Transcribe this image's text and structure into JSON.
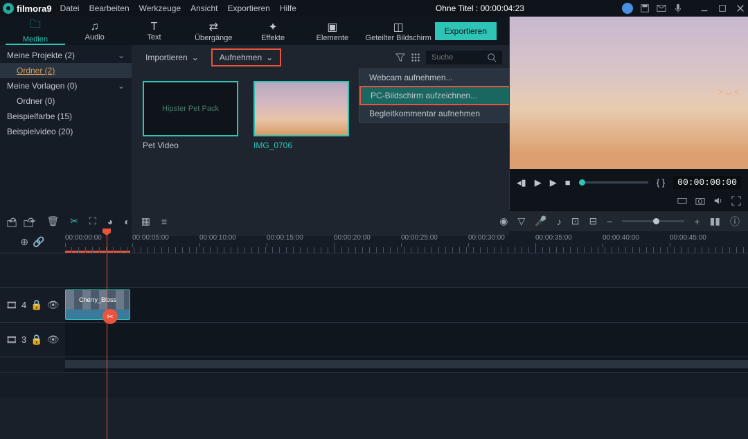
{
  "app": {
    "logo_text": "filmora9"
  },
  "menu": [
    "Datei",
    "Bearbeiten",
    "Werkzeuge",
    "Ansicht",
    "Exportieren",
    "Hilfe"
  ],
  "title": "Ohne Titel : 00:00:04:23",
  "tabs": [
    {
      "label": "Medien",
      "icon": "folder"
    },
    {
      "label": "Audio",
      "icon": "music"
    },
    {
      "label": "Text",
      "icon": "text"
    },
    {
      "label": "Übergänge",
      "icon": "transition"
    },
    {
      "label": "Effekte",
      "icon": "effects"
    },
    {
      "label": "Elemente",
      "icon": "elements"
    },
    {
      "label": "Geteilter Bildschirm",
      "icon": "split"
    }
  ],
  "export_btn": "Exportieren",
  "import_label": "Importieren",
  "record_label": "Aufnehmen",
  "record_menu": [
    "Webcam aufnehmen...",
    "PC-Bildschirm aufzeichnen...",
    "Begleitkommentar aufnehmen"
  ],
  "sidebar": {
    "items": [
      {
        "label": "Meine Projekte (2)",
        "expand": true
      },
      {
        "label": "Ordner  (2)",
        "sub": true,
        "selected": true
      },
      {
        "label": "Meine Vorlagen (0)",
        "expand": true
      },
      {
        "label": "Ordner (0)",
        "sub_plain": true
      },
      {
        "label": "Beispielfarbe (15)"
      },
      {
        "label": "Beispielvideo (20)"
      }
    ]
  },
  "search_placeholder": "Suche",
  "thumbs": [
    {
      "label": "Pet Video",
      "overlay": "Hipster Pet Pack"
    },
    {
      "label": "IMG_0706"
    }
  ],
  "preview": {
    "timecode": "00:00:00:00",
    "markers": "{  }"
  },
  "ruler": [
    "00:00:00:00",
    "00:00:05:00",
    "00:00:10:00",
    "00:00:15:00",
    "00:00:20:00",
    "00:00:25:00",
    "00:00:30:00",
    "00:00:35:00",
    "00:00:40:00",
    "00:00:45:00"
  ],
  "tracks": [
    {
      "id": "4",
      "icon": "film"
    },
    {
      "id": "3",
      "icon": "film"
    }
  ],
  "clip_label": "Cherry_Bloss"
}
